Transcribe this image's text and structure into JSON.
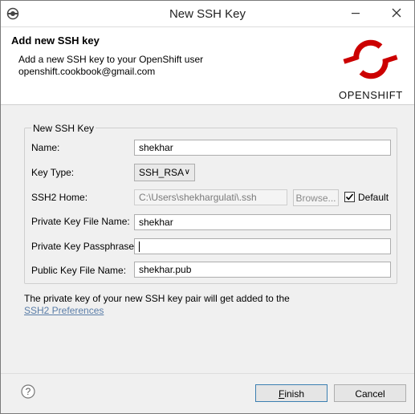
{
  "window": {
    "title": "New SSH Key",
    "minimize_icon": "minimize-icon",
    "close_icon": "close-icon"
  },
  "banner": {
    "title": "Add new SSH key",
    "description_line1": "Add a new SSH key to your OpenShift user",
    "description_line2": "openshift.cookbook@gmail.com",
    "logo_text": "OPENSHIFT",
    "logo_color": "#cc0000"
  },
  "group": {
    "label": "New SSH Key",
    "name_label": "Name:",
    "name_value": "shekhar",
    "key_type_label": "Key Type:",
    "key_type_value": "SSH_RSA",
    "ssh2_home_label": "SSH2 Home:",
    "ssh2_home_value": "C:\\Users\\shekhargulati\\.ssh",
    "browse_label": "Browse...",
    "default_label": "Default",
    "default_checked": true,
    "private_key_label": "Private Key File Name:",
    "private_key_value": "shekhar",
    "passphrase_label": "Private Key Passphrase:",
    "passphrase_value": "",
    "public_key_label": "Public Key File Name:",
    "public_key_value": "shekhar.pub"
  },
  "note": {
    "text": "The private key of your new SSH key pair will get added to the",
    "link": "SSH2 Preferences"
  },
  "footer": {
    "finish_label": "Finish",
    "finish_mnemonic": "F",
    "finish_rest": "inish",
    "cancel_label": "Cancel"
  }
}
